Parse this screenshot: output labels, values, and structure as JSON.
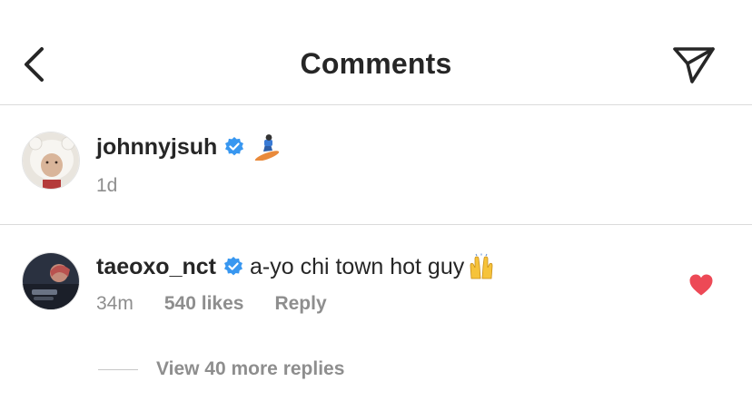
{
  "header": {
    "title": "Comments",
    "back_icon": "chevron-left-icon",
    "share_icon": "paper-plane-icon"
  },
  "caption": {
    "username": "johnnyjsuh",
    "verified": true,
    "text": "",
    "emoji": "snowboarder-emoji",
    "time": "1d"
  },
  "comment": {
    "username": "taeoxo_nct",
    "verified": true,
    "text": "a-yo chi town hot guy",
    "emoji": "raising-hands-emoji",
    "time": "34m",
    "likes": "540 likes",
    "reply_label": "Reply",
    "liked": true,
    "view_replies": "View 40 more replies"
  },
  "colors": {
    "text_primary": "#262626",
    "text_secondary": "#8e8e8e",
    "divider": "#dbdbdb",
    "verified_blue": "#3897f0",
    "heart_red": "#ed4956"
  }
}
